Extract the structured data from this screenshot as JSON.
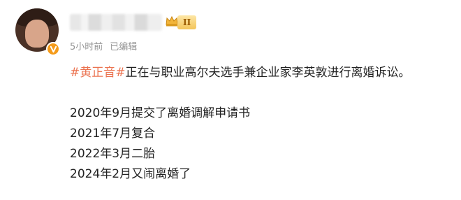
{
  "post": {
    "meta": {
      "time": "5小时前",
      "edited": "已编辑"
    },
    "level_badge": "II",
    "content": {
      "hashtag": "#黄正音#",
      "first_line_rest": "正在与职业高尔夫选手兼企业家李英敦进行离婚诉讼。",
      "timeline": [
        "2020年9月提交了离婚调解申请书",
        "2021年7月复合",
        "2022年3月二胎",
        "2024年2月又闹离婚了"
      ]
    },
    "icons": {
      "avatar": "avatar",
      "verified": "verified-v-icon",
      "crown": "crown-icon"
    },
    "colors": {
      "hashtag": "#eb7350",
      "meta_text": "#939393",
      "verified_badge": "#f59b1a"
    }
  }
}
